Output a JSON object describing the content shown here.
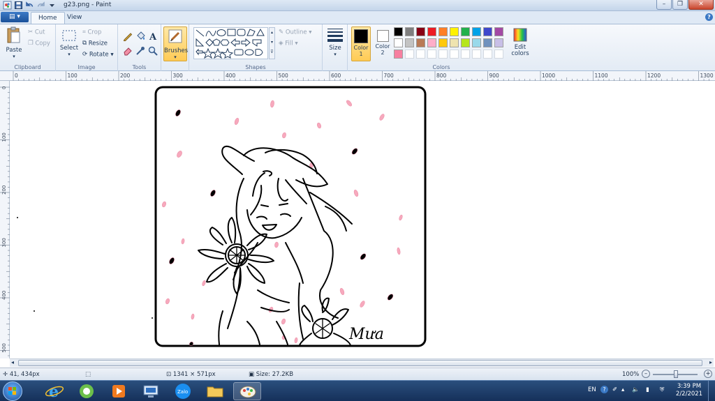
{
  "window": {
    "title": "g23.png - Paint",
    "buttons": {
      "minimize": "–",
      "maximize": "❐",
      "close": "✕"
    }
  },
  "ribbon": {
    "file_menu": "▤ ▾",
    "tabs": [
      "Home",
      "View"
    ],
    "groups": {
      "clipboard": {
        "label": "Clipboard",
        "paste": "Paste",
        "cut": "Cut",
        "copy": "Copy"
      },
      "image": {
        "label": "Image",
        "select": "Select",
        "crop": "Crop",
        "resize": "Resize",
        "rotate": "Rotate"
      },
      "tools": {
        "label": "Tools"
      },
      "brushes": {
        "label": "Brushes"
      },
      "shapes": {
        "label": "Shapes",
        "outline": "Outline",
        "fill": "Fill"
      },
      "size": {
        "label": "Size"
      },
      "colors": {
        "label": "Colors",
        "color1": "Color 1",
        "color2": "Color 2",
        "edit_colors": "Edit colors",
        "color1_value": "#000000",
        "color2_value": "#ffffff",
        "palette_row1": [
          "#000000",
          "#7f7f7f",
          "#880015",
          "#ed1c24",
          "#ff7f27",
          "#fff200",
          "#22b14c",
          "#00a2e8",
          "#3f48cc",
          "#a349a4"
        ],
        "palette_row2": [
          "#ffffff",
          "#c3c3c3",
          "#b97a57",
          "#ffaec9",
          "#ffc90e",
          "#efe4b0",
          "#b5e61d",
          "#99d9ea",
          "#7092be",
          "#c8bfe7"
        ],
        "palette_row3": [
          "#f77fa0",
          "",
          "",
          "",
          "",
          "",
          "",
          "",
          "",
          ""
        ]
      }
    }
  },
  "ruler": {
    "h_labels": [
      "0",
      "100",
      "200",
      "300",
      "400",
      "500",
      "600",
      "700",
      "800",
      "900",
      "1000",
      "1100",
      "1200",
      "1300"
    ],
    "v_labels": [
      "0",
      "100",
      "200",
      "300",
      "400",
      "500"
    ]
  },
  "drawing": {
    "signature": "Mưa"
  },
  "statusbar": {
    "cursor_pos": "41, 434px",
    "dimensions": "1341 × 571px",
    "size": "Size: 27.2KB",
    "zoom": "100%"
  },
  "taskbar": {
    "apps": [
      "start-orb",
      "internet-explorer",
      "coc-coc-browser",
      "media-player",
      "network-app",
      "zalo",
      "file-explorer",
      "paint"
    ],
    "language": "EN",
    "time": "3:39 PM",
    "date": "2/2/2021"
  }
}
